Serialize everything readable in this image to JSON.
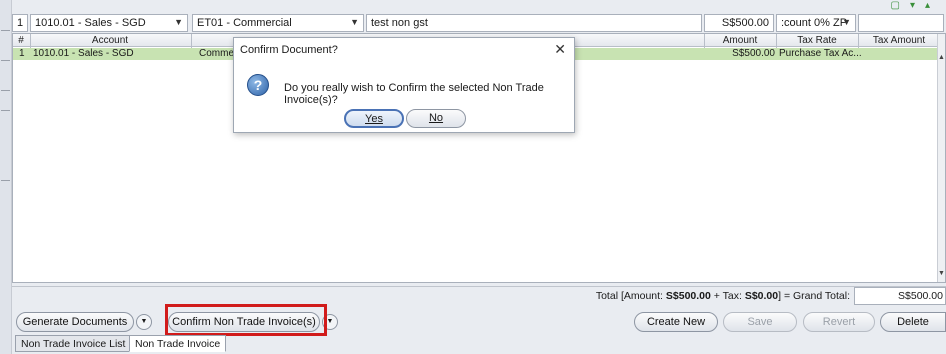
{
  "input_row": {
    "line_no": "1",
    "account": "1010.01 - Sales - SGD",
    "entity_type": "ET01 - Commercial",
    "description": "test non gst",
    "amount": "S$500.00",
    "tax_rate": ":count 0% ZP"
  },
  "grid": {
    "headers": [
      "#",
      "Account",
      "Amount",
      "Tax Rate",
      "Tax Amount"
    ],
    "rows": [
      {
        "no": "1",
        "account": "1010.01 - Sales - SGD",
        "entity_type": "Comme",
        "amount": "S$500.00",
        "tax_rate": "Purchase Tax Ac..."
      }
    ]
  },
  "totals": {
    "prefix": "Total [Amount:",
    "amount": "S$500.00",
    "plus_tax": "+ Tax:",
    "tax": "S$0.00",
    "grand_label": "] =  Grand Total:",
    "grand_total": "S$500.00"
  },
  "toolbar": {
    "generate_documents": "Generate Documents",
    "confirm_nti": "Confirm Non Trade Invoice(s)",
    "create_new": "Create New",
    "save": "Save",
    "revert": "Revert",
    "delete": "Delete"
  },
  "tabs": [
    {
      "label": "Non Trade Invoice List",
      "active": false
    },
    {
      "label": "Non Trade Invoice",
      "active": true
    }
  ],
  "dialog": {
    "title": "Confirm Document?",
    "message": "Do you really wish to Confirm the selected Non Trade Invoice(s)?",
    "yes_label": "Yes",
    "no_label": "No"
  },
  "colors": {
    "selected_row": "#c8e3b2",
    "highlight": "#d11b1b",
    "primary_border": "#4a72b5"
  }
}
